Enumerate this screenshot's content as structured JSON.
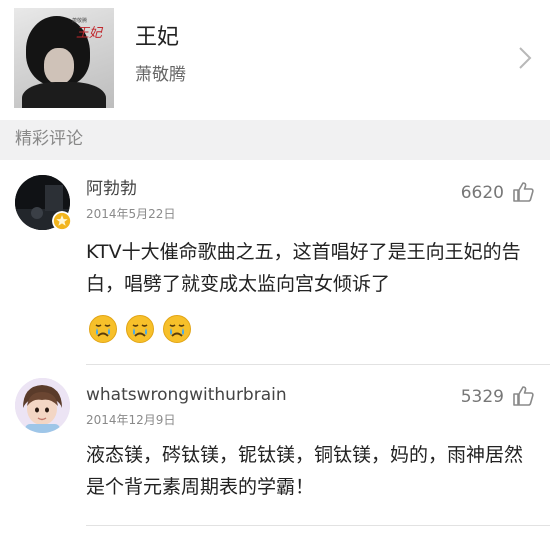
{
  "song": {
    "title": "王妃",
    "artist": "萧敬腾",
    "cover_text": "王妃",
    "cover_small_text": "萧敬腾"
  },
  "section": {
    "title": "精彩评论"
  },
  "comments": [
    {
      "username": "阿勃勃",
      "date": "2014年5月22日",
      "likes": "6620",
      "text": "KTV十大催命歌曲之五，这首唱好了是王向王妃的告白，唱劈了就变成太监向宫女倾诉了",
      "emoji_count": 3
    },
    {
      "username": "whatswrongwithurbrain",
      "date": "2014年12月9日",
      "likes": "5329",
      "text": "液态镁，硶钛镁，铌钛镁，铜钛镁，妈的，雨神居然是个背元素周期表的学霸！"
    }
  ],
  "colors": {
    "section_bg": "#f1f1f2",
    "badge": "#f2b51d",
    "emoji_face": "#f7c02a",
    "tear": "#3fa9f5"
  },
  "icons": {
    "chevron": "chevron-right-icon",
    "like": "thumbs-up-icon",
    "emoji": "crying-face-icon",
    "badge": "vip-star-badge-icon"
  }
}
